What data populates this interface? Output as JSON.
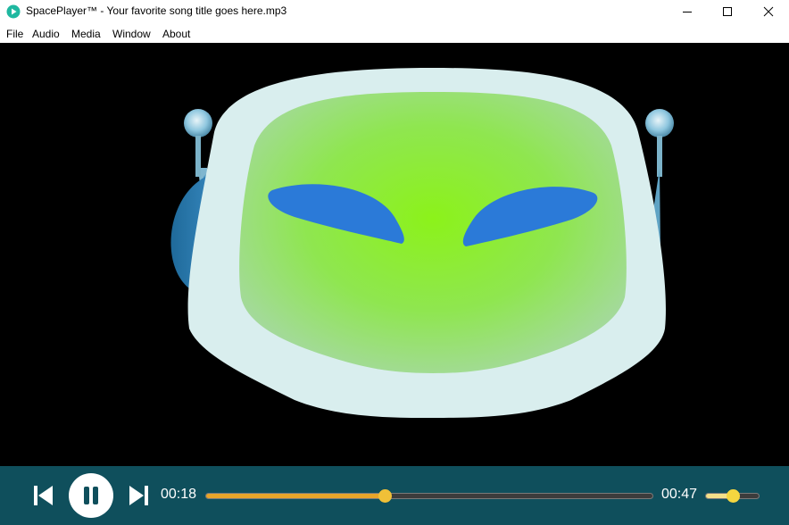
{
  "window": {
    "title": "SpacePlayer™ - Your favorite song title goes here.mp3",
    "minimize_icon": "minimize-icon",
    "maximize_icon": "maximize-icon",
    "close_icon": "close-icon"
  },
  "menu": {
    "items": [
      {
        "label": "File"
      },
      {
        "label": "Audio"
      },
      {
        "label": "Media"
      },
      {
        "label": "Window"
      },
      {
        "label": "About"
      }
    ]
  },
  "video": {
    "artwork": "alien-robot-head-logo",
    "background": "#000000"
  },
  "player": {
    "current_time": "00:18",
    "total_time": "00:47",
    "progress": 0.4,
    "volume": 0.5,
    "prev_icon": "skip-previous-icon",
    "pause_icon": "pause-icon",
    "next_icon": "skip-next-icon",
    "colors": {
      "bar": "#0f4f5c",
      "seek": "#e8a52a",
      "volume": "#f5d640"
    }
  }
}
